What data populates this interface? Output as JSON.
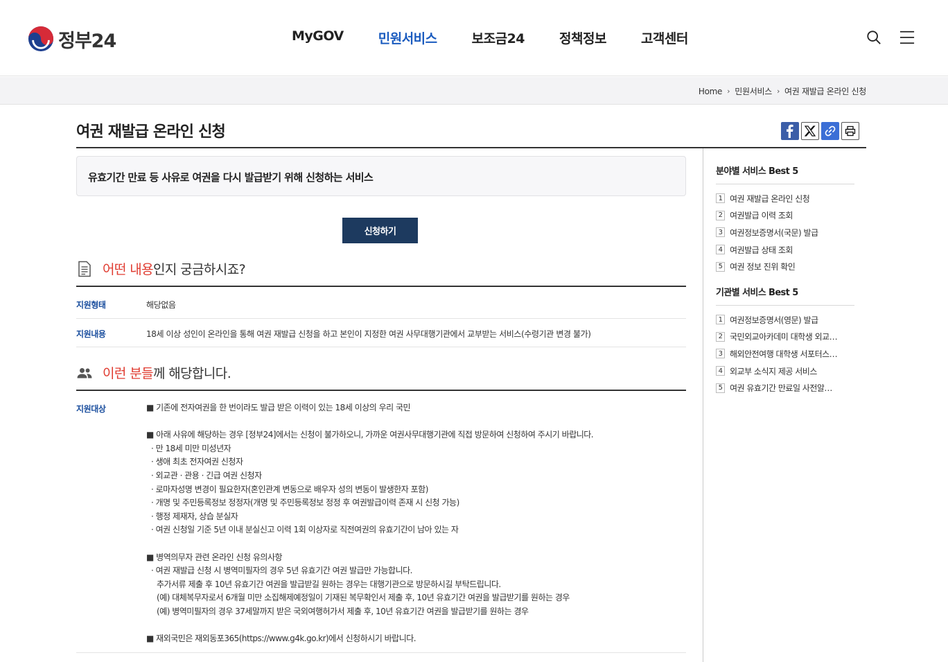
{
  "header": {
    "logo_text": "정부24",
    "nav": [
      {
        "label": "MyGOV",
        "active": false
      },
      {
        "label": "민원서비스",
        "active": true
      },
      {
        "label": "보조금24",
        "active": false
      },
      {
        "label": "정책정보",
        "active": false
      },
      {
        "label": "고객센터",
        "active": false
      }
    ]
  },
  "breadcrumb": [
    "Home",
    "민원서비스",
    "여권 재발급 온라인 신청"
  ],
  "page": {
    "title": "여권 재발급 온라인 신청",
    "summary": "유효기간 만료 등 사유로 여권을 다시 발급받기 위해 신청하는 서비스",
    "apply_label": "신청하기"
  },
  "section1": {
    "title_red": "어떤 내용",
    "title_rest": "인지 궁금하시죠?",
    "rows": [
      {
        "label": "지원형태",
        "value": "해당없음"
      },
      {
        "label": "지원내용",
        "value": "18세 이상 성인이 온라인을 통해 여권 재발급 신청을 하고 본인이 지정한 여권 사무대행기관에서 교부받는 서비스(수령기관 변경 불가)"
      }
    ]
  },
  "section2": {
    "title_red": "이런 분들",
    "title_rest": "께 해당합니다.",
    "label": "지원대상",
    "lines": [
      "■ 기존에 전자여권을 한 번이라도 발급 받은 이력이 있는 18세 이상의 우리 국민",
      "",
      "■ 아래 사유에 해당하는 경우 [정부24]에서는 신청이 불가하오니, 가까운 여권사무대행기관에 직접 방문하여 신청하여 주시기 바랍니다.",
      "· 만 18세 미만 미성년자",
      "· 생애 최초 전자여권 신청자",
      "· 외교관 · 관용 · 긴급 여권 신청자",
      "· 로마자성명 변경이 필요한자(혼인관계 변동으로 배우자 성의 변동이 발생한자 포함)",
      "· 개명 및 주민등록정보 정정자(개명 및 주민등록정보 정정 후 여권발급이력 존재 시 신청 가능)",
      "· 행정 제재자, 상습 분실자",
      "· 여권 신청일 기준 5년 이내 분실신고 이력 1회 이상자로 직전여권의 유효기간이 남아 있는 자",
      "",
      "■ 병역의무자 관련 온라인 신청 유의사항",
      "· 여권 재발급 신청 시 병역미필자의 경우 5년 유효기간 여권 발급만 가능합니다.",
      "추가서류 제출 후 10년 유효기간 여권을 발급받길 원하는 경우는 대행기관으로 방문하시길 부탁드립니다.",
      "(예) 대체복무자로서 6개월 미만 소집해제예정일이 기재된 복무확인서 제출 후, 10년 유효기간 여권을 발급받기를 원하는 경우",
      "(예) 병역미필자의 경우 37세말까지 받은 국외여행허가서 제출 후, 10년 유효기간 여권을 발급받기를 원하는 경우",
      "",
      "■ 재외국민은 재외동포365(https://www.g4k.go.kr)에서 신청하시기 바랍니다."
    ]
  },
  "sidebar": {
    "best_field": {
      "title": "분야별 서비스 Best 5",
      "items": [
        {
          "num": "1",
          "label": "여권 재발급 온라인 신청"
        },
        {
          "num": "2",
          "label": "여권발급 이력 조회"
        },
        {
          "num": "3",
          "label": "여권정보증명서(국문) 발급"
        },
        {
          "num": "4",
          "label": "여권발급 상태 조회"
        },
        {
          "num": "5",
          "label": "여권 정보 진위 확인"
        }
      ]
    },
    "best_agency": {
      "title": "기관별 서비스 Best 5",
      "items": [
        {
          "num": "1",
          "label": "여권정보증명서(영문) 발급"
        },
        {
          "num": "2",
          "label": "국민외교아카데미 대학생 외교…"
        },
        {
          "num": "3",
          "label": "해외안전여행 대학생 서포터스…"
        },
        {
          "num": "4",
          "label": "외교부 소식지 제공 서비스"
        },
        {
          "num": "5",
          "label": "여권 유효기간 만료일 사전알…"
        }
      ]
    }
  },
  "colors": {
    "accent_blue": "#1a5bbf",
    "label_blue": "#1a4e9e",
    "highlight_red": "#e03c31",
    "button_navy": "#1d3a5f"
  }
}
